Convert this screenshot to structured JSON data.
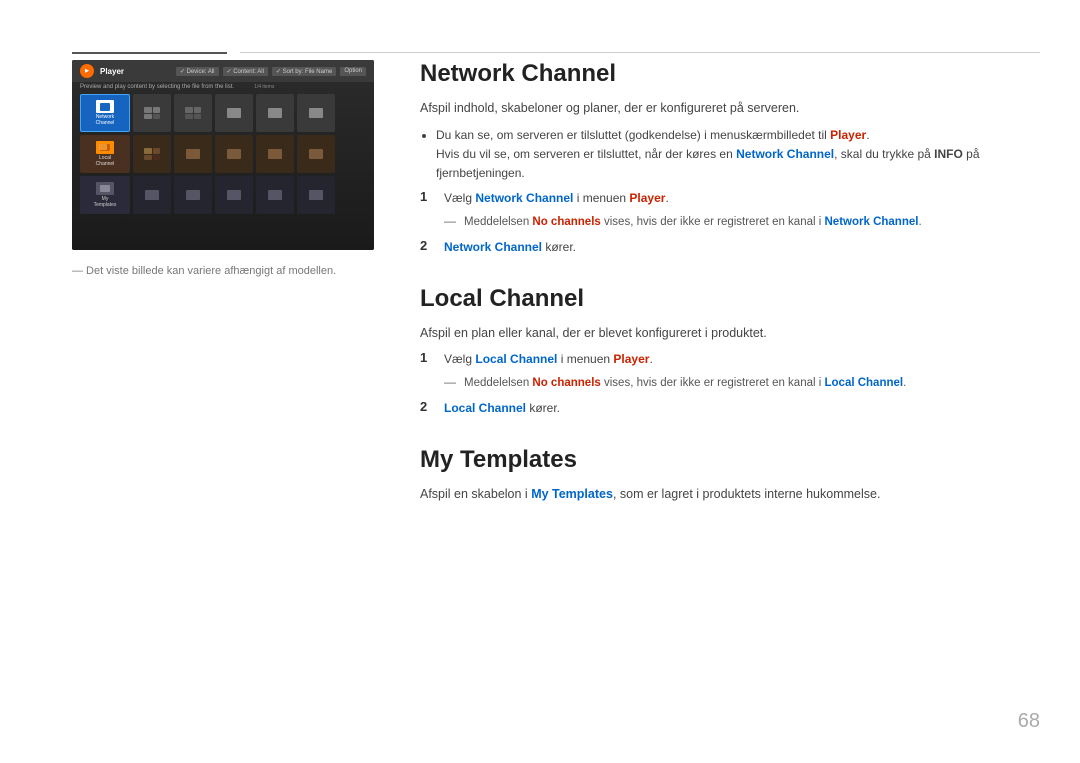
{
  "page": {
    "number": "68"
  },
  "topbar": {
    "active_line_color": "#555555"
  },
  "left_panel": {
    "caption": "― Det viste billede kan variere afhængigt af modellen.",
    "player_ui": {
      "title": "Player",
      "controls": [
        "Device: All",
        "Content: All",
        "Sort by: File Name",
        "Option"
      ],
      "subtitle": "Preview and play content by selecting the file from the list.",
      "count": "1 / 4 items",
      "row_labels": [
        "Network Channel",
        "Local Channel",
        "My Templates"
      ],
      "grid_selected": "Network Channel"
    }
  },
  "sections": {
    "network_channel": {
      "title": "Network Channel",
      "description": "Afspil indhold, skabeloner og planer, der er konfigureret på serveren.",
      "bullets": [
        {
          "text_before": "Du kan se, om serveren er tilsluttet (godkendelse) i menuskærmbilledet til ",
          "highlight1": "Player",
          "highlight1_color": "red",
          "text_after": ".",
          "text_line2_before": "Hvis du vil se, om serveren er tilsluttet, når der køres en ",
          "highlight2": "Network Channel",
          "highlight2_color": "blue",
          "text_line2_mid": ", skal du trykke på ",
          "highlight3": "INFO",
          "highlight3_bold": true,
          "text_line2_after": " på fjernbetjeningen."
        }
      ],
      "step1": {
        "number": "1",
        "text_before": "Vælg ",
        "highlight1": "Network Channel",
        "highlight1_color": "blue",
        "text_mid": " i menuen ",
        "highlight2": "Player",
        "highlight2_color": "red",
        "text_after": "."
      },
      "note1": {
        "dash": "―",
        "text_before": "Meddelelsen ",
        "highlight1": "No channels",
        "highlight1_color": "red",
        "text_mid": " vises, hvis der ikke er registreret en kanal i ",
        "highlight2": "Network Channel",
        "highlight2_color": "blue",
        "text_after": "."
      },
      "step2": {
        "number": "2",
        "highlight1": "Network Channel",
        "highlight1_color": "blue",
        "text_after": " kører."
      }
    },
    "local_channel": {
      "title": "Local Channel",
      "description": "Afspil en plan eller kanal, der er blevet konfigureret i produktet.",
      "step1": {
        "number": "1",
        "text_before": "Vælg ",
        "highlight1": "Local Channel",
        "highlight1_color": "blue",
        "text_mid": " i menuen ",
        "highlight2": "Player",
        "highlight2_color": "red",
        "text_after": "."
      },
      "note1": {
        "dash": "―",
        "text_before": "Meddelelsen ",
        "highlight1": "No channels",
        "highlight1_color": "red",
        "text_mid": " vises, hvis der ikke er registreret en kanal i ",
        "highlight2": "Local Channel",
        "highlight2_color": "blue",
        "text_after": "."
      },
      "step2": {
        "number": "2",
        "highlight1": "Local Channel",
        "highlight1_color": "blue",
        "text_after": " kører."
      }
    },
    "my_templates": {
      "title": "My Templates",
      "description_before": "Afspil en skabelon i ",
      "highlight1": "My Templates",
      "highlight1_color": "blue",
      "description_after": ", som er lagret i produktets interne hukommelse."
    }
  }
}
